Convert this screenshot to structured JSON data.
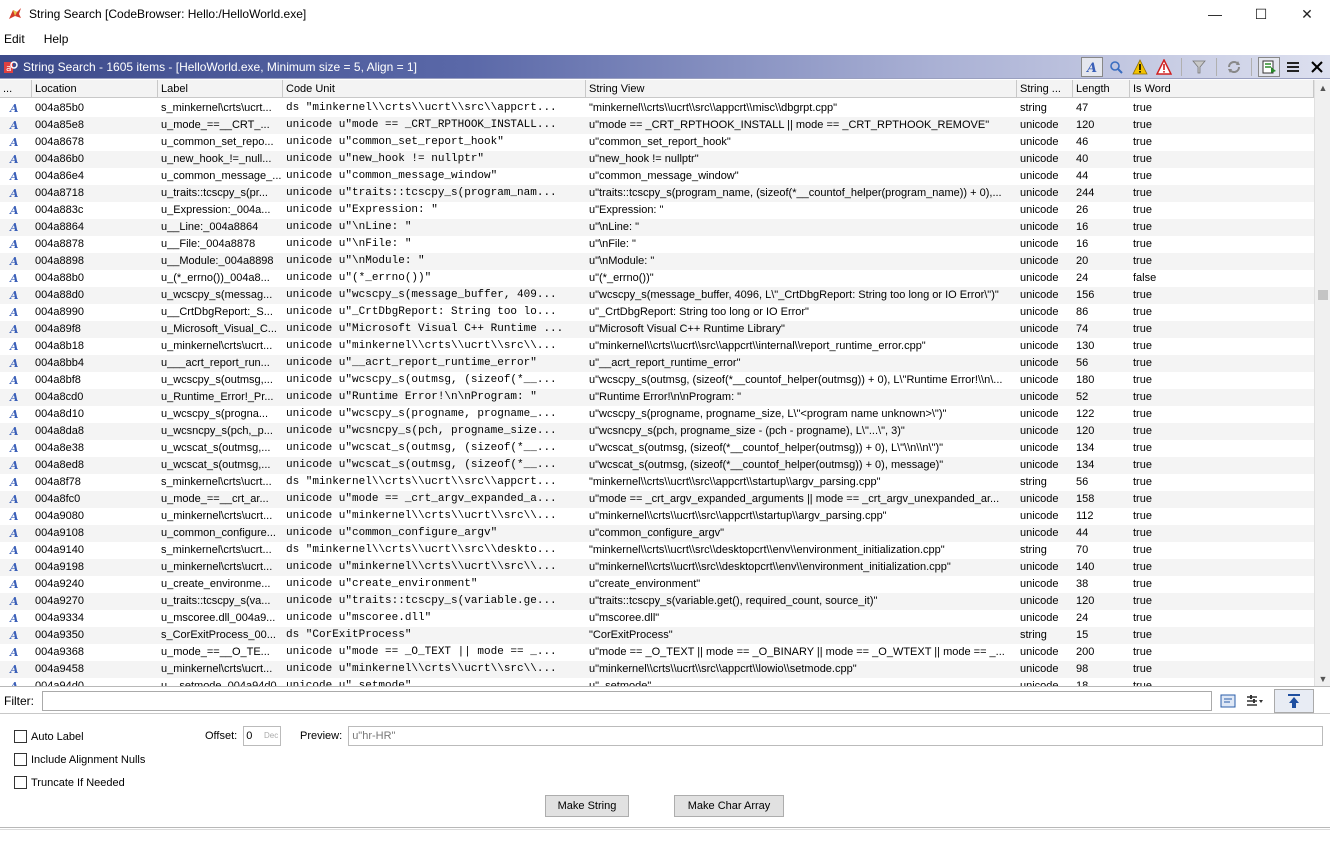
{
  "window": {
    "title": "String Search [CodeBrowser: Hello:/HelloWorld.exe]",
    "minimize": "—",
    "maximize": "☐",
    "close": "✕"
  },
  "menu": [
    "Edit",
    "Help"
  ],
  "component": {
    "title": "String Search - 1605 items - [HelloWorld.exe, Minimum size = 5, Align = 1]"
  },
  "table": {
    "columns": {
      "icon": "...",
      "location": "Location",
      "label": "Label",
      "code_unit": "Code Unit",
      "string_view": "String View",
      "string_type": "String ...",
      "length": "Length",
      "is_word": "Is Word"
    },
    "rows": [
      {
        "location": "004a85b0",
        "label": "s_minkernel\\crts\\ucrt...",
        "code": "ds \"minkernel\\\\crts\\\\ucrt\\\\src\\\\appcrt...",
        "view": "\"minkernel\\\\crts\\\\ucrt\\\\src\\\\appcrt\\\\misc\\\\dbgrpt.cpp\"",
        "type": "string",
        "length": "47",
        "word": "true"
      },
      {
        "location": "004a85e8",
        "label": "u_mode_==__CRT_...",
        "code": "unicode u\"mode == _CRT_RPTHOOK_INSTALL...",
        "view": "u\"mode == _CRT_RPTHOOK_INSTALL || mode == _CRT_RPTHOOK_REMOVE\"",
        "type": "unicode",
        "length": "120",
        "word": "true"
      },
      {
        "location": "004a8678",
        "label": "u_common_set_repo...",
        "code": "unicode u\"common_set_report_hook\"",
        "view": "u\"common_set_report_hook\"",
        "type": "unicode",
        "length": "46",
        "word": "true"
      },
      {
        "location": "004a86b0",
        "label": "u_new_hook_!=_null...",
        "code": "unicode u\"new_hook != nullptr\"",
        "view": "u\"new_hook != nullptr\"",
        "type": "unicode",
        "length": "40",
        "word": "true"
      },
      {
        "location": "004a86e4",
        "label": "u_common_message_...",
        "code": "unicode u\"common_message_window\"",
        "view": "u\"common_message_window\"",
        "type": "unicode",
        "length": "44",
        "word": "true"
      },
      {
        "location": "004a8718",
        "label": "u_traits::tcscpy_s(pr...",
        "code": "unicode u\"traits::tcscpy_s(program_nam...",
        "view": "u\"traits::tcscpy_s(program_name, (sizeof(*__countof_helper(program_name)) + 0),...",
        "type": "unicode",
        "length": "244",
        "word": "true"
      },
      {
        "location": "004a883c",
        "label": "u_Expression:_004a...",
        "code": "unicode u\"Expression: \"",
        "view": "u\"Expression: \"",
        "type": "unicode",
        "length": "26",
        "word": "true"
      },
      {
        "location": "004a8864",
        "label": "u__Line:_004a8864",
        "code": "unicode u\"\\nLine: \"",
        "view": "u\"\\nLine: \"",
        "type": "unicode",
        "length": "16",
        "word": "true"
      },
      {
        "location": "004a8878",
        "label": "u__File:_004a8878",
        "code": "unicode u\"\\nFile: \"",
        "view": "u\"\\nFile: \"",
        "type": "unicode",
        "length": "16",
        "word": "true"
      },
      {
        "location": "004a8898",
        "label": "u__Module:_004a8898",
        "code": "unicode u\"\\nModule: \"",
        "view": "u\"\\nModule: \"",
        "type": "unicode",
        "length": "20",
        "word": "true"
      },
      {
        "location": "004a88b0",
        "label": "u_(*_errno())_004a8...",
        "code": "unicode u\"(*_errno())\"",
        "view": "u\"(*_errno())\"",
        "type": "unicode",
        "length": "24",
        "word": "false"
      },
      {
        "location": "004a88d0",
        "label": "u_wcscpy_s(messag...",
        "code": "unicode u\"wcscpy_s(message_buffer, 409...",
        "view": "u\"wcscpy_s(message_buffer, 4096, L\\\"_CrtDbgReport: String too long or IO Error\\\")\"",
        "type": "unicode",
        "length": "156",
        "word": "true"
      },
      {
        "location": "004a8990",
        "label": "u__CrtDbgReport:_S...",
        "code": "unicode u\"_CrtDbgReport: String too lo...",
        "view": "u\"_CrtDbgReport: String too long or IO Error\"",
        "type": "unicode",
        "length": "86",
        "word": "true"
      },
      {
        "location": "004a89f8",
        "label": "u_Microsoft_Visual_C...",
        "code": "unicode u\"Microsoft Visual C++ Runtime ...",
        "view": "u\"Microsoft Visual C++ Runtime Library\"",
        "type": "unicode",
        "length": "74",
        "word": "true"
      },
      {
        "location": "004a8b18",
        "label": "u_minkernel\\crts\\ucrt...",
        "code": "unicode u\"minkernel\\\\crts\\\\ucrt\\\\src\\\\...",
        "view": "u\"minkernel\\\\crts\\\\ucrt\\\\src\\\\appcrt\\\\internal\\\\report_runtime_error.cpp\"",
        "type": "unicode",
        "length": "130",
        "word": "true"
      },
      {
        "location": "004a8bb4",
        "label": "u___acrt_report_run...",
        "code": "unicode u\"__acrt_report_runtime_error\"",
        "view": "u\"__acrt_report_runtime_error\"",
        "type": "unicode",
        "length": "56",
        "word": "true"
      },
      {
        "location": "004a8bf8",
        "label": "u_wcscpy_s(outmsg,...",
        "code": "unicode u\"wcscpy_s(outmsg, (sizeof(*__...",
        "view": "u\"wcscpy_s(outmsg, (sizeof(*__countof_helper(outmsg)) + 0), L\\\"Runtime Error!\\\\n\\...",
        "type": "unicode",
        "length": "180",
        "word": "true"
      },
      {
        "location": "004a8cd0",
        "label": "u_Runtime_Error!_Pr...",
        "code": "unicode u\"Runtime Error!\\n\\nProgram: \"",
        "view": "u\"Runtime Error!\\n\\nProgram: \"",
        "type": "unicode",
        "length": "52",
        "word": "true"
      },
      {
        "location": "004a8d10",
        "label": "u_wcscpy_s(progna...",
        "code": "unicode u\"wcscpy_s(progname, progname_...",
        "view": "u\"wcscpy_s(progname, progname_size, L\\\"<program name unknown>\\\")\"",
        "type": "unicode",
        "length": "122",
        "word": "true"
      },
      {
        "location": "004a8da8",
        "label": "u_wcsncpy_s(pch,_p...",
        "code": "unicode u\"wcsncpy_s(pch, progname_size...",
        "view": "u\"wcsncpy_s(pch, progname_size - (pch - progname), L\\\"...\\\", 3)\"",
        "type": "unicode",
        "length": "120",
        "word": "true"
      },
      {
        "location": "004a8e38",
        "label": "u_wcscat_s(outmsg,...",
        "code": "unicode u\"wcscat_s(outmsg, (sizeof(*__...",
        "view": "u\"wcscat_s(outmsg, (sizeof(*__countof_helper(outmsg)) + 0), L\\\"\\\\n\\\\n\\\")\"",
        "type": "unicode",
        "length": "134",
        "word": "true"
      },
      {
        "location": "004a8ed8",
        "label": "u_wcscat_s(outmsg,...",
        "code": "unicode u\"wcscat_s(outmsg, (sizeof(*__...",
        "view": "u\"wcscat_s(outmsg, (sizeof(*__countof_helper(outmsg)) + 0), message)\"",
        "type": "unicode",
        "length": "134",
        "word": "true"
      },
      {
        "location": "004a8f78",
        "label": "s_minkernel\\crts\\ucrt...",
        "code": "ds \"minkernel\\\\crts\\\\ucrt\\\\src\\\\appcrt...",
        "view": "\"minkernel\\\\crts\\\\ucrt\\\\src\\\\appcrt\\\\startup\\\\argv_parsing.cpp\"",
        "type": "string",
        "length": "56",
        "word": "true"
      },
      {
        "location": "004a8fc0",
        "label": "u_mode_==__crt_ar...",
        "code": "unicode u\"mode == _crt_argv_expanded_a...",
        "view": "u\"mode == _crt_argv_expanded_arguments || mode == _crt_argv_unexpanded_ar...",
        "type": "unicode",
        "length": "158",
        "word": "true"
      },
      {
        "location": "004a9080",
        "label": "u_minkernel\\crts\\ucrt...",
        "code": "unicode u\"minkernel\\\\crts\\\\ucrt\\\\src\\\\...",
        "view": "u\"minkernel\\\\crts\\\\ucrt\\\\src\\\\appcrt\\\\startup\\\\argv_parsing.cpp\"",
        "type": "unicode",
        "length": "112",
        "word": "true"
      },
      {
        "location": "004a9108",
        "label": "u_common_configure...",
        "code": "unicode u\"common_configure_argv\"",
        "view": "u\"common_configure_argv\"",
        "type": "unicode",
        "length": "44",
        "word": "true"
      },
      {
        "location": "004a9140",
        "label": "s_minkernel\\crts\\ucrt...",
        "code": "ds \"minkernel\\\\crts\\\\ucrt\\\\src\\\\deskto...",
        "view": "\"minkernel\\\\crts\\\\ucrt\\\\src\\\\desktopcrt\\\\env\\\\environment_initialization.cpp\"",
        "type": "string",
        "length": "70",
        "word": "true"
      },
      {
        "location": "004a9198",
        "label": "u_minkernel\\crts\\ucrt...",
        "code": "unicode u\"minkernel\\\\crts\\\\ucrt\\\\src\\\\...",
        "view": "u\"minkernel\\\\crts\\\\ucrt\\\\src\\\\desktopcrt\\\\env\\\\environment_initialization.cpp\"",
        "type": "unicode",
        "length": "140",
        "word": "true"
      },
      {
        "location": "004a9240",
        "label": "u_create_environme...",
        "code": "unicode u\"create_environment\"",
        "view": "u\"create_environment\"",
        "type": "unicode",
        "length": "38",
        "word": "true"
      },
      {
        "location": "004a9270",
        "label": "u_traits::tcscpy_s(va...",
        "code": "unicode u\"traits::tcscpy_s(variable.ge...",
        "view": "u\"traits::tcscpy_s(variable.get(), required_count, source_it)\"",
        "type": "unicode",
        "length": "120",
        "word": "true"
      },
      {
        "location": "004a9334",
        "label": "u_mscoree.dll_004a9...",
        "code": "unicode u\"mscoree.dll\"",
        "view": "u\"mscoree.dll\"",
        "type": "unicode",
        "length": "24",
        "word": "true"
      },
      {
        "location": "004a9350",
        "label": "s_CorExitProcess_00...",
        "code": "ds \"CorExitProcess\"",
        "view": "\"CorExitProcess\"",
        "type": "string",
        "length": "15",
        "word": "true"
      },
      {
        "location": "004a9368",
        "label": "u_mode_==__O_TE...",
        "code": "unicode u\"mode == _O_TEXT || mode == _...",
        "view": "u\"mode == _O_TEXT || mode == _O_BINARY || mode == _O_WTEXT || mode == _...",
        "type": "unicode",
        "length": "200",
        "word": "true"
      },
      {
        "location": "004a9458",
        "label": "u_minkernel\\crts\\ucrt...",
        "code": "unicode u\"minkernel\\\\crts\\\\ucrt\\\\src\\\\...",
        "view": "u\"minkernel\\\\crts\\\\ucrt\\\\src\\\\appcrt\\\\lowio\\\\setmode.cpp\"",
        "type": "unicode",
        "length": "98",
        "word": "true"
      },
      {
        "location": "004a94d0",
        "label": "u__setmode_004a94d0",
        "code": "unicode u\"_setmode\"",
        "view": "u\"_setmode\"",
        "type": "unicode",
        "length": "18",
        "word": "true"
      }
    ]
  },
  "filter": {
    "label": "Filter:",
    "value": ""
  },
  "options": {
    "auto_label": "Auto Label",
    "include_alignment_nulls": "Include Alignment Nulls",
    "truncate_if_needed": "Truncate If Needed",
    "offset_label": "Offset:",
    "offset_value": "0",
    "offset_unit": "Dec",
    "preview_label": "Preview:",
    "preview_value": "u\"hr-HR\""
  },
  "buttons": {
    "make_string": "Make String",
    "make_char_array": "Make Char Array"
  },
  "colors": {
    "header_gradient_start": "#3c4a8a",
    "string_icon": "#3a5fb8"
  }
}
